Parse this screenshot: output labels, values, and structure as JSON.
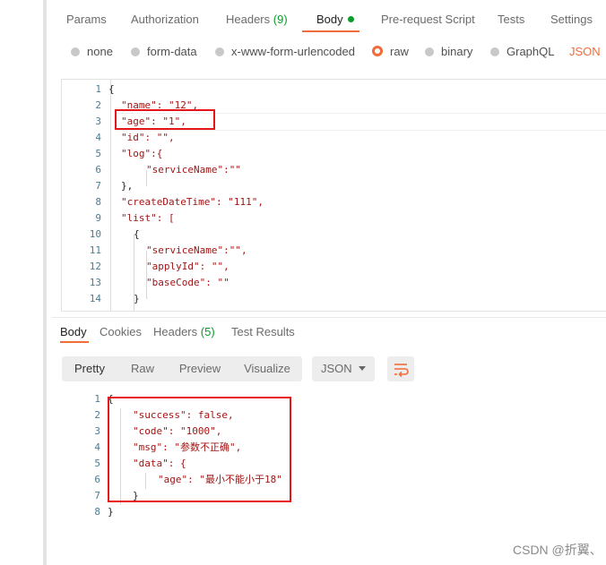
{
  "request_tabs": [
    {
      "label": "Params"
    },
    {
      "label": "Authorization"
    },
    {
      "label": "Headers",
      "count": "(9)"
    },
    {
      "label": "Body"
    },
    {
      "label": "Pre-request Script"
    },
    {
      "label": "Tests"
    },
    {
      "label": "Settings"
    }
  ],
  "body_types": [
    {
      "label": "none"
    },
    {
      "label": "form-data"
    },
    {
      "label": "x-www-form-urlencoded"
    },
    {
      "label": "raw"
    },
    {
      "label": "binary"
    },
    {
      "label": "GraphQL"
    }
  ],
  "raw_format": "JSON",
  "request_body": {
    "lines": [
      {
        "n": "1",
        "t": "{"
      },
      {
        "n": "2",
        "t": "\"name\": \"12\","
      },
      {
        "n": "3",
        "t": "\"age\": \"1\","
      },
      {
        "n": "4",
        "t": "\"id\": \"\","
      },
      {
        "n": "5",
        "t": "\"log\":{"
      },
      {
        "n": "6",
        "t": "\"serviceName\":\"\""
      },
      {
        "n": "7",
        "t": "},"
      },
      {
        "n": "8",
        "t": "\"createDateTime\": \"111\","
      },
      {
        "n": "9",
        "t": "\"list\": ["
      },
      {
        "n": "10",
        "t": "{"
      },
      {
        "n": "11",
        "t": "\"serviceName\":\"\","
      },
      {
        "n": "12",
        "t": "\"applyId\": \"\","
      },
      {
        "n": "13",
        "t": "\"baseCode\": \"\""
      },
      {
        "n": "14",
        "t": "}"
      }
    ]
  },
  "response_tabs": [
    {
      "label": "Body"
    },
    {
      "label": "Cookies"
    },
    {
      "label": "Headers",
      "count": "(5)"
    },
    {
      "label": "Test Results"
    }
  ],
  "view_modes": [
    {
      "label": "Pretty"
    },
    {
      "label": "Raw"
    },
    {
      "label": "Preview"
    },
    {
      "label": "Visualize"
    }
  ],
  "response_format": "JSON",
  "wrap_icon": "wrap-lines-icon",
  "response_body": {
    "lines": [
      {
        "n": "1",
        "t": "{"
      },
      {
        "n": "2",
        "t": "\"success\": false,"
      },
      {
        "n": "3",
        "t": "\"code\": \"1000\","
      },
      {
        "n": "4",
        "t": "\"msg\": \"参数不正确\","
      },
      {
        "n": "5",
        "t": "\"data\": {"
      },
      {
        "n": "6",
        "t": "\"age\": \"最小不能小于18\""
      },
      {
        "n": "7",
        "t": "}"
      },
      {
        "n": "8",
        "t": "}"
      }
    ]
  },
  "watermark": "CSDN @折翼、",
  "colors": {
    "accent": "#f26b3a",
    "count_green": "#0c9c2a",
    "highlight_box": "#e5151b"
  }
}
